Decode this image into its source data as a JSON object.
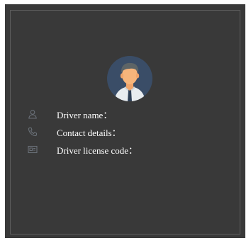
{
  "driver_card": {
    "avatar": "driver-avatar",
    "fields": [
      {
        "icon": "person-icon",
        "label": "Driver name："
      },
      {
        "icon": "phone-icon",
        "label": "Contact details："
      },
      {
        "icon": "id-card-icon",
        "label": "Driver license code："
      }
    ]
  },
  "colors": {
    "background": "#393939",
    "border": "#5d5d5d",
    "icon": "#6a7078",
    "text": "#ffffff",
    "avatar_bg": "#3a4d67"
  }
}
